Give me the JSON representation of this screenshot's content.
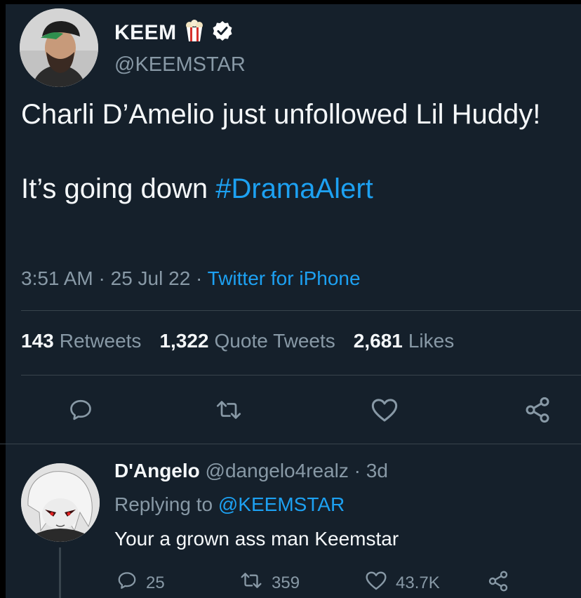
{
  "tweet": {
    "display_name": "KEEM",
    "handle": "@KEEMSTAR",
    "text_line1": "Charli D’Amelio just unfollowed Lil Huddy!",
    "text_line2_prefix": "It’s going down ",
    "hashtag": "#DramaAlert",
    "time": "3:51 AM",
    "date": "25 Jul 22",
    "source": "Twitter for iPhone",
    "sep": " · "
  },
  "stats": {
    "retweets_count": "143",
    "retweets_label": "Retweets",
    "quotes_count": "1,322",
    "quotes_label": "Quote Tweets",
    "likes_count": "2,681",
    "likes_label": "Likes"
  },
  "icons": {
    "name_emoji": "popcorn-icon",
    "verified": "verified-badge-icon",
    "reply": "reply-icon",
    "retweet": "retweet-icon",
    "like": "heart-icon",
    "share": "share-icon"
  },
  "reply": {
    "display_name": "D'Angelo",
    "handle": "@dangelo4realz",
    "time": "3d",
    "replying_prefix": "Replying to ",
    "replying_handle": "@KEEMSTAR",
    "text": "Your a grown ass man Keemstar",
    "reply_count": "25",
    "retweet_count": "359",
    "like_count": "43.7K"
  },
  "colors": {
    "background": "#15202b",
    "accent": "#1da1f2",
    "secondary_text": "#8899a6",
    "divider": "#38444d"
  }
}
